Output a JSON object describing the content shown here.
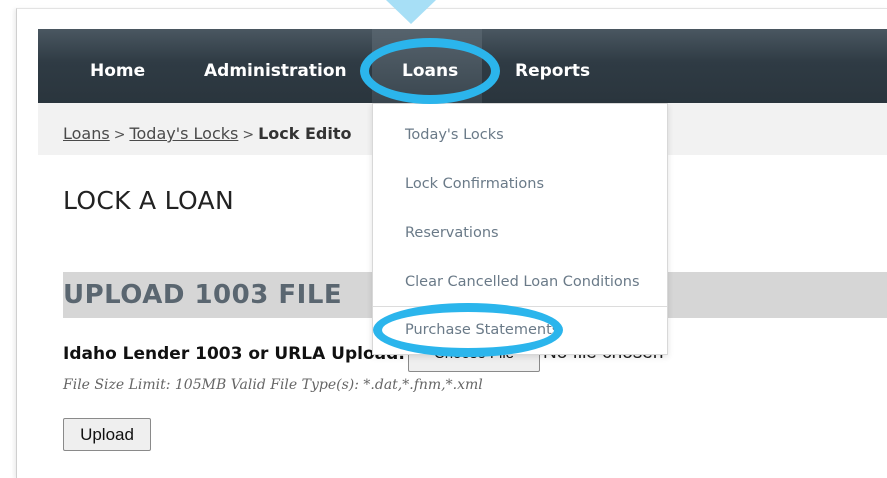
{
  "nav": {
    "home": "Home",
    "administration": "Administration",
    "loans": "Loans",
    "reports": "Reports"
  },
  "breadcrumb": {
    "loans": "Loans",
    "sep1": ">",
    "todays_locks": "Today's Locks",
    "sep2": ">",
    "current": "Lock Edito"
  },
  "page": {
    "title": "LOCK A LOAN",
    "section_title": "UPLOAD 1003 FILE"
  },
  "upload": {
    "label": "Idaho Lender 1003 or URLA Upload:",
    "choose_button": "Choose File",
    "no_file": "No file chosen",
    "limit_text": "File Size Limit: 105MB Valid File Type(s): *.dat,*.fnm,*.xml",
    "upload_button": "Upload"
  },
  "dropdown": {
    "items": [
      "Today's Locks",
      "Lock Confirmations",
      "Reservations",
      "Clear Cancelled Loan Conditions",
      "Purchase Statements"
    ]
  },
  "colors": {
    "navbar": "#2f3b44",
    "highlight_ring": "#2bb5ec",
    "arrow": "#a7dff6",
    "dropdown_text": "#6a7a88",
    "section_bar": "#d6d6d6"
  }
}
